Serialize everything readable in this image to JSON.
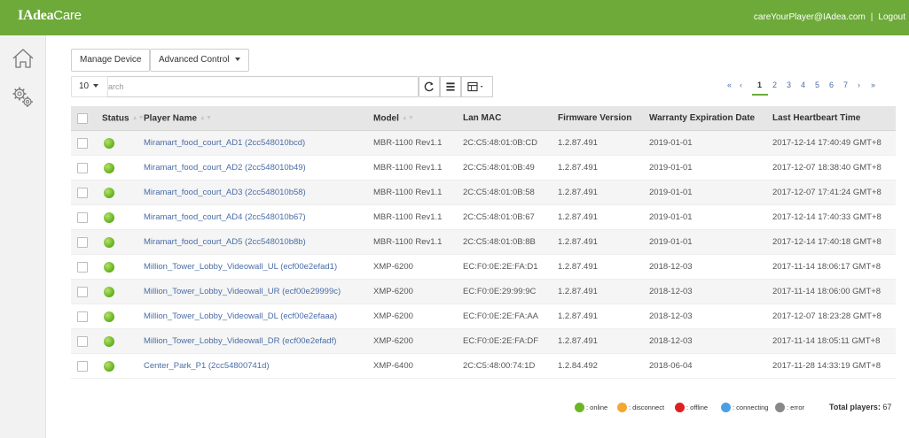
{
  "header": {
    "brand_bold": "IAdea",
    "brand_rest": "Care",
    "user_email": "careYourPlayer@IAdea.com",
    "separator": "|",
    "logout_label": "Logout"
  },
  "sidebar": {
    "items": [
      {
        "name": "home",
        "icon": "home-icon"
      },
      {
        "name": "settings",
        "icon": "gears-icon"
      }
    ]
  },
  "toolbar": {
    "manage_device_label": "Manage Device",
    "advanced_control_label": "Advanced Control",
    "page_size_value": "10",
    "search_placeholder": "Search",
    "tool_icons": [
      "refresh-icon",
      "list-view-icon",
      "columns-icon"
    ]
  },
  "pagination": {
    "first": "«",
    "prev": "‹",
    "pages": [
      "1",
      "2",
      "3",
      "4",
      "5",
      "6",
      "7"
    ],
    "current": "1",
    "next": "›",
    "last": "»"
  },
  "table": {
    "columns": [
      "Status",
      "Player Name",
      "Model",
      "Lan MAC",
      "Firmware Version",
      "Warranty Expiration Date",
      "Last Heartbeart Time"
    ],
    "rows": [
      {
        "status": "online",
        "name": "Miramart_food_court_AD1 (2cc548010bcd)",
        "model": "MBR-1100 Rev1.1",
        "mac": "2C:C5:48:01:0B:CD",
        "firmware": "1.2.87.491",
        "warranty": "2019-01-01",
        "heartbeat": "2017-12-14 17:40:49 GMT+8"
      },
      {
        "status": "online",
        "name": "Miramart_food_court_AD2 (2cc548010b49)",
        "model": "MBR-1100 Rev1.1",
        "mac": "2C:C5:48:01:0B:49",
        "firmware": "1.2.87.491",
        "warranty": "2019-01-01",
        "heartbeat": "2017-12-07 18:38:40 GMT+8"
      },
      {
        "status": "online",
        "name": "Miramart_food_court_AD3 (2cc548010b58)",
        "model": "MBR-1100 Rev1.1",
        "mac": "2C:C5:48:01:0B:58",
        "firmware": "1.2.87.491",
        "warranty": "2019-01-01",
        "heartbeat": "2017-12-07 17:41:24 GMT+8"
      },
      {
        "status": "online",
        "name": "Miramart_food_court_AD4 (2cc548010b67)",
        "model": "MBR-1100 Rev1.1",
        "mac": "2C:C5:48:01:0B:67",
        "firmware": "1.2.87.491",
        "warranty": "2019-01-01",
        "heartbeat": "2017-12-14 17:40:33 GMT+8"
      },
      {
        "status": "online",
        "name": "Miramart_food_court_AD5 (2cc548010b8b)",
        "model": "MBR-1100 Rev1.1",
        "mac": "2C:C5:48:01:0B:8B",
        "firmware": "1.2.87.491",
        "warranty": "2019-01-01",
        "heartbeat": "2017-12-14 17:40:18 GMT+8"
      },
      {
        "status": "online",
        "name": "Million_Tower_Lobby_Videowall_UL (ecf00e2efad1)",
        "model": "XMP-6200",
        "mac": "EC:F0:0E:2E:FA:D1",
        "firmware": "1.2.87.491",
        "warranty": "2018-12-03",
        "heartbeat": "2017-11-14 18:06:17 GMT+8"
      },
      {
        "status": "online",
        "name": "Million_Tower_Lobby_Videowall_UR (ecf00e29999c)",
        "model": "XMP-6200",
        "mac": "EC:F0:0E:29:99:9C",
        "firmware": "1.2.87.491",
        "warranty": "2018-12-03",
        "heartbeat": "2017-11-14 18:06:00 GMT+8"
      },
      {
        "status": "online",
        "name": "Million_Tower_Lobby_Videowall_DL (ecf00e2efaaa)",
        "model": "XMP-6200",
        "mac": "EC:F0:0E:2E:FA:AA",
        "firmware": "1.2.87.491",
        "warranty": "2018-12-03",
        "heartbeat": "2017-12-07 18:23:28 GMT+8"
      },
      {
        "status": "online",
        "name": "Million_Tower_Lobby_Videowall_DR (ecf00e2efadf)",
        "model": "XMP-6200",
        "mac": "EC:F0:0E:2E:FA:DF",
        "firmware": "1.2.87.491",
        "warranty": "2018-12-03",
        "heartbeat": "2017-11-14 18:05:11 GMT+8"
      },
      {
        "status": "online",
        "name": "Center_Park_P1 (2cc54800741d)",
        "model": "XMP-6400",
        "mac": "2C:C5:48:00:74:1D",
        "firmware": "1.2.84.492",
        "warranty": "2018-06-04",
        "heartbeat": "2017-11-28 14:33:19 GMT+8"
      }
    ]
  },
  "legend": {
    "items": [
      {
        "label": ": online",
        "color": "#6cb626"
      },
      {
        "label": ": disconnect",
        "color": "#f0a830"
      },
      {
        "label": ": offline",
        "color": "#e02020"
      },
      {
        "label": ": connecting",
        "color": "#4a9ee8"
      },
      {
        "label": ": error",
        "color": "#888888"
      }
    ],
    "total_label": "Total players:",
    "total_value": "67"
  },
  "colors": {
    "brand_green": "#6daa3a",
    "link_blue": "#4a6da7"
  }
}
